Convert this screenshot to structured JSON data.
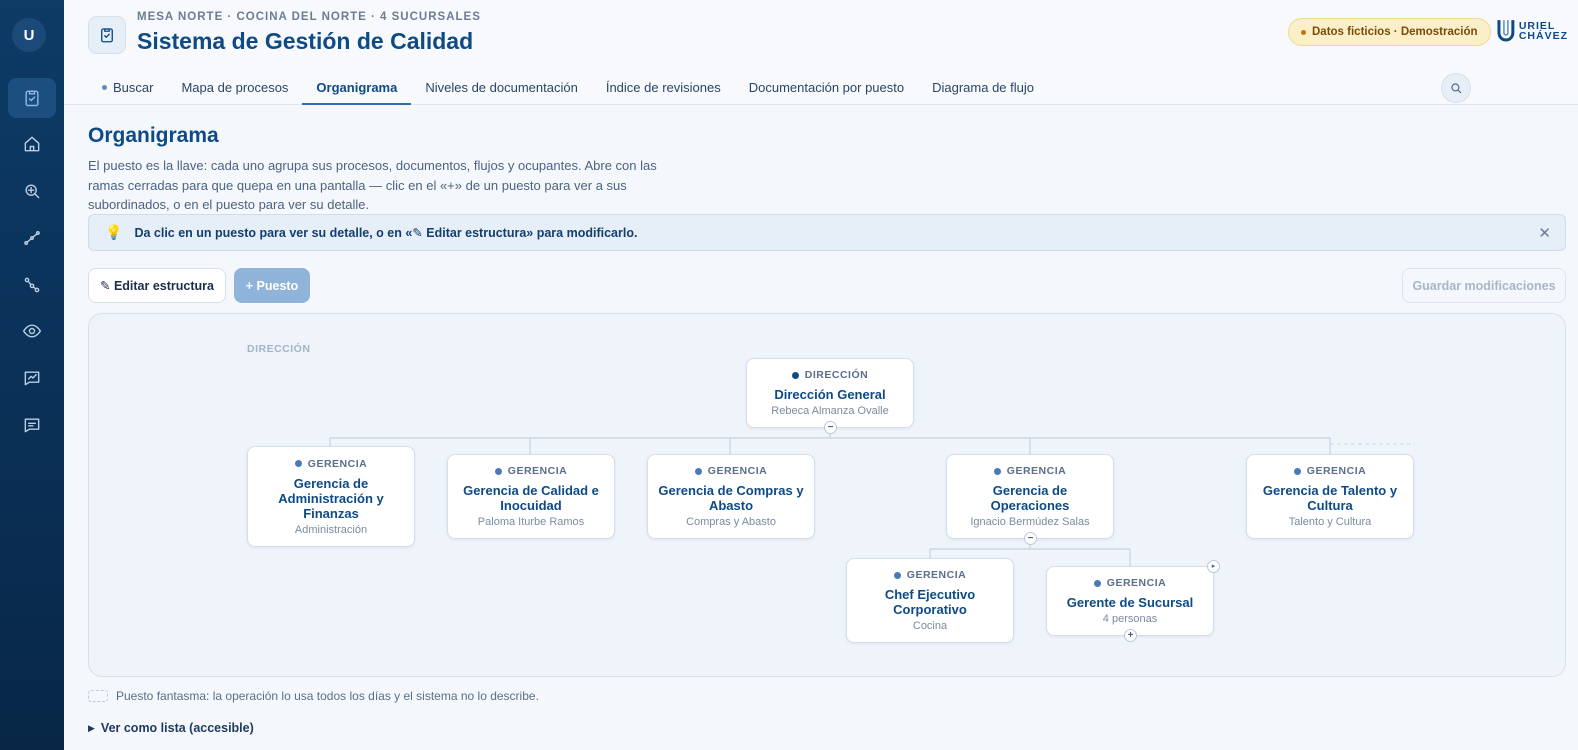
{
  "sidebar": {
    "avatar_initial": "U"
  },
  "header": {
    "eyebrow": "MESA NORTE · COCINA DEL NORTE · 4 SUCURSALES",
    "title": "Sistema de Gestión de Calidad",
    "badge": "Datos ficticios · Demostración",
    "logo_line1": "URIEL",
    "logo_line2": "CHÁVEZ"
  },
  "tabs": [
    {
      "label": "Buscar"
    },
    {
      "label": "Mapa de procesos"
    },
    {
      "label": "Organigrama"
    },
    {
      "label": "Niveles de documentación"
    },
    {
      "label": "Índice de revisiones"
    },
    {
      "label": "Documentación por puesto"
    },
    {
      "label": "Diagrama de flujo"
    }
  ],
  "main": {
    "title": "Organigrama",
    "description": "El puesto es la llave: cada uno agrupa sus procesos, documentos, flujos y ocupantes. Abre con las ramas cerradas para que quepa en una pantalla — clic en el «+» de un puesto para ver a sus subordinados, o en el puesto para ver su detalle.",
    "hint": "Da clic en un puesto para ver su detalle, o en «✎ Editar estructura» para modificarlo.",
    "edit_button": "✎ Editar estructura",
    "add_button": "+ Puesto",
    "save_button": "Guardar modificaciones",
    "level_label": "DIRECCIÓN",
    "legend": "Puesto fantasma: la operación lo usa todos los días y el sistema no lo describe.",
    "list_toggle": "Ver como lista (accesible)"
  },
  "org": {
    "direccion": {
      "kind": "DIRECCIÓN",
      "name": "Dirección General",
      "sub": "Rebeca Almanza Ovalle"
    },
    "admin": {
      "kind": "GERENCIA",
      "name": "Gerencia de Administración y Finanzas",
      "sub": "Administración"
    },
    "calidad": {
      "kind": "GERENCIA",
      "name": "Gerencia de Calidad e Inocuidad",
      "sub": "Paloma Iturbe Ramos"
    },
    "compras": {
      "kind": "GERENCIA",
      "name": "Gerencia de Compras y Abasto",
      "sub": "Compras y Abasto"
    },
    "operaciones": {
      "kind": "GERENCIA",
      "name": "Gerencia de Operaciones",
      "sub": "Ignacio Bermúdez Salas"
    },
    "talento": {
      "kind": "GERENCIA",
      "name": "Gerencia de Talento y Cultura",
      "sub": "Talento y Cultura"
    },
    "chef": {
      "kind": "GERENCIA",
      "name": "Chef Ejecutivo Corporativo",
      "sub": "Cocina"
    },
    "sucursal": {
      "kind": "GERENCIA",
      "name": "Gerente de Sucursal",
      "sub": "4 personas"
    }
  },
  "colors": {
    "brand": "#0d4a86",
    "sidebar": "#0d3b66",
    "badge_bg": "#fbefc9"
  }
}
